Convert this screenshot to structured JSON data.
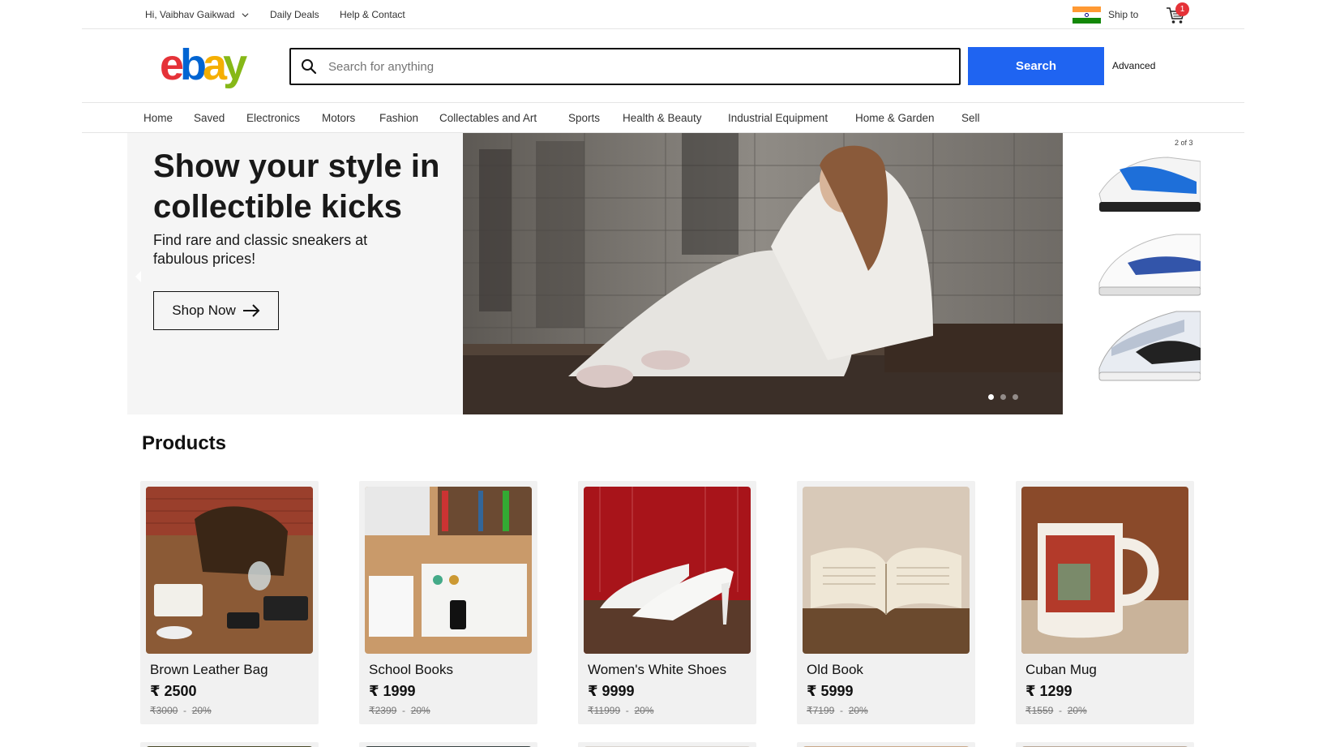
{
  "topbar": {
    "greeting": "Hi, Vaibhav Gaikwad",
    "daily_deals": "Daily Deals",
    "help": "Help & Contact",
    "ship_to": "Ship to",
    "cart_count": "1"
  },
  "search": {
    "placeholder": "Search for anything",
    "button_label": "Search",
    "advanced_label": "Advanced"
  },
  "nav": {
    "items": [
      "Home",
      "Saved",
      "Electronics",
      "Motors",
      "Fashion",
      "Collectables and Art",
      "Sports",
      "Health & Beauty",
      "Industrial Equipment",
      "Home & Garden",
      "Sell"
    ]
  },
  "hero": {
    "title": "Show your style in collectible kicks",
    "subtitle": "Find rare and classic sneakers at fabulous prices!",
    "cta": "Shop Now",
    "pager": "2 of 3"
  },
  "products": {
    "title": "Products",
    "items": [
      {
        "name": "Brown Leather Bag",
        "price": "₹ 2500",
        "old_price": "₹3000",
        "discount": "20%"
      },
      {
        "name": "School Books",
        "price": "₹ 1999",
        "old_price": "₹2399",
        "discount": "20%"
      },
      {
        "name": "Women's White Shoes",
        "price": "₹ 9999",
        "old_price": "₹11999",
        "discount": "20%"
      },
      {
        "name": "Old Book",
        "price": "₹ 5999",
        "old_price": "₹7199",
        "discount": "20%"
      },
      {
        "name": "Cuban Mug",
        "price": "₹ 1299",
        "old_price": "₹1559",
        "discount": "20%"
      }
    ]
  },
  "colors": {
    "search_button": "#1f64f1",
    "logo_e": "#e53238",
    "logo_b": "#0064d2",
    "logo_a": "#f5af02",
    "logo_y": "#86b817"
  }
}
